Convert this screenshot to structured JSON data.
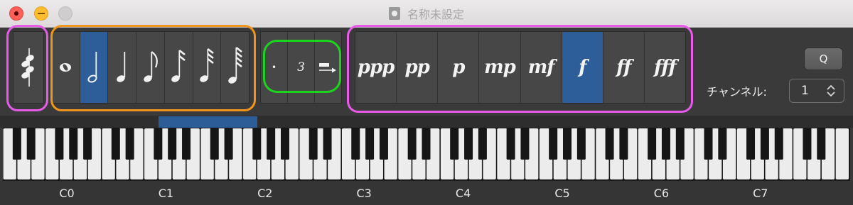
{
  "window": {
    "title": "名称未設定"
  },
  "palette": {
    "chord_tool": {
      "icon": "chord-notes-icon",
      "frame_color": "#e85be8"
    },
    "note_values": {
      "frame_color": "#f0961e",
      "items": [
        {
          "name": "whole-note-icon",
          "selected": false
        },
        {
          "name": "half-note-icon",
          "selected": true
        },
        {
          "name": "quarter-note-icon",
          "selected": false
        },
        {
          "name": "eighth-note-icon",
          "selected": false
        },
        {
          "name": "sixteenth-note-icon",
          "selected": false
        },
        {
          "name": "thirty-second-note-icon",
          "selected": false
        },
        {
          "name": "sixty-fourth-note-icon",
          "selected": false
        }
      ]
    },
    "modifiers": {
      "frame_color": "#1ed31e",
      "dot_label": "•",
      "triplet_label": "3",
      "sustain_icon": "sustain-arrow-icon"
    },
    "dynamics": {
      "frame_color": "#e85be8",
      "items": [
        {
          "label": "ppp",
          "selected": false
        },
        {
          "label": "pp",
          "selected": false
        },
        {
          "label": "p",
          "selected": false
        },
        {
          "label": "mp",
          "selected": false
        },
        {
          "label": "mf",
          "selected": false
        },
        {
          "label": "f",
          "selected": true
        },
        {
          "label": "ff",
          "selected": false
        },
        {
          "label": "fff",
          "selected": false
        }
      ]
    },
    "selected_color": "#2d5e9a"
  },
  "controls": {
    "q_label": "Q",
    "channel_label": "チャンネル:",
    "channel_value": "1"
  },
  "keyboard": {
    "octave_labels": [
      "C0",
      "C1",
      "C2",
      "C3",
      "C4",
      "C5",
      "C6",
      "C7"
    ],
    "highlight_color": "#2c5d96"
  }
}
